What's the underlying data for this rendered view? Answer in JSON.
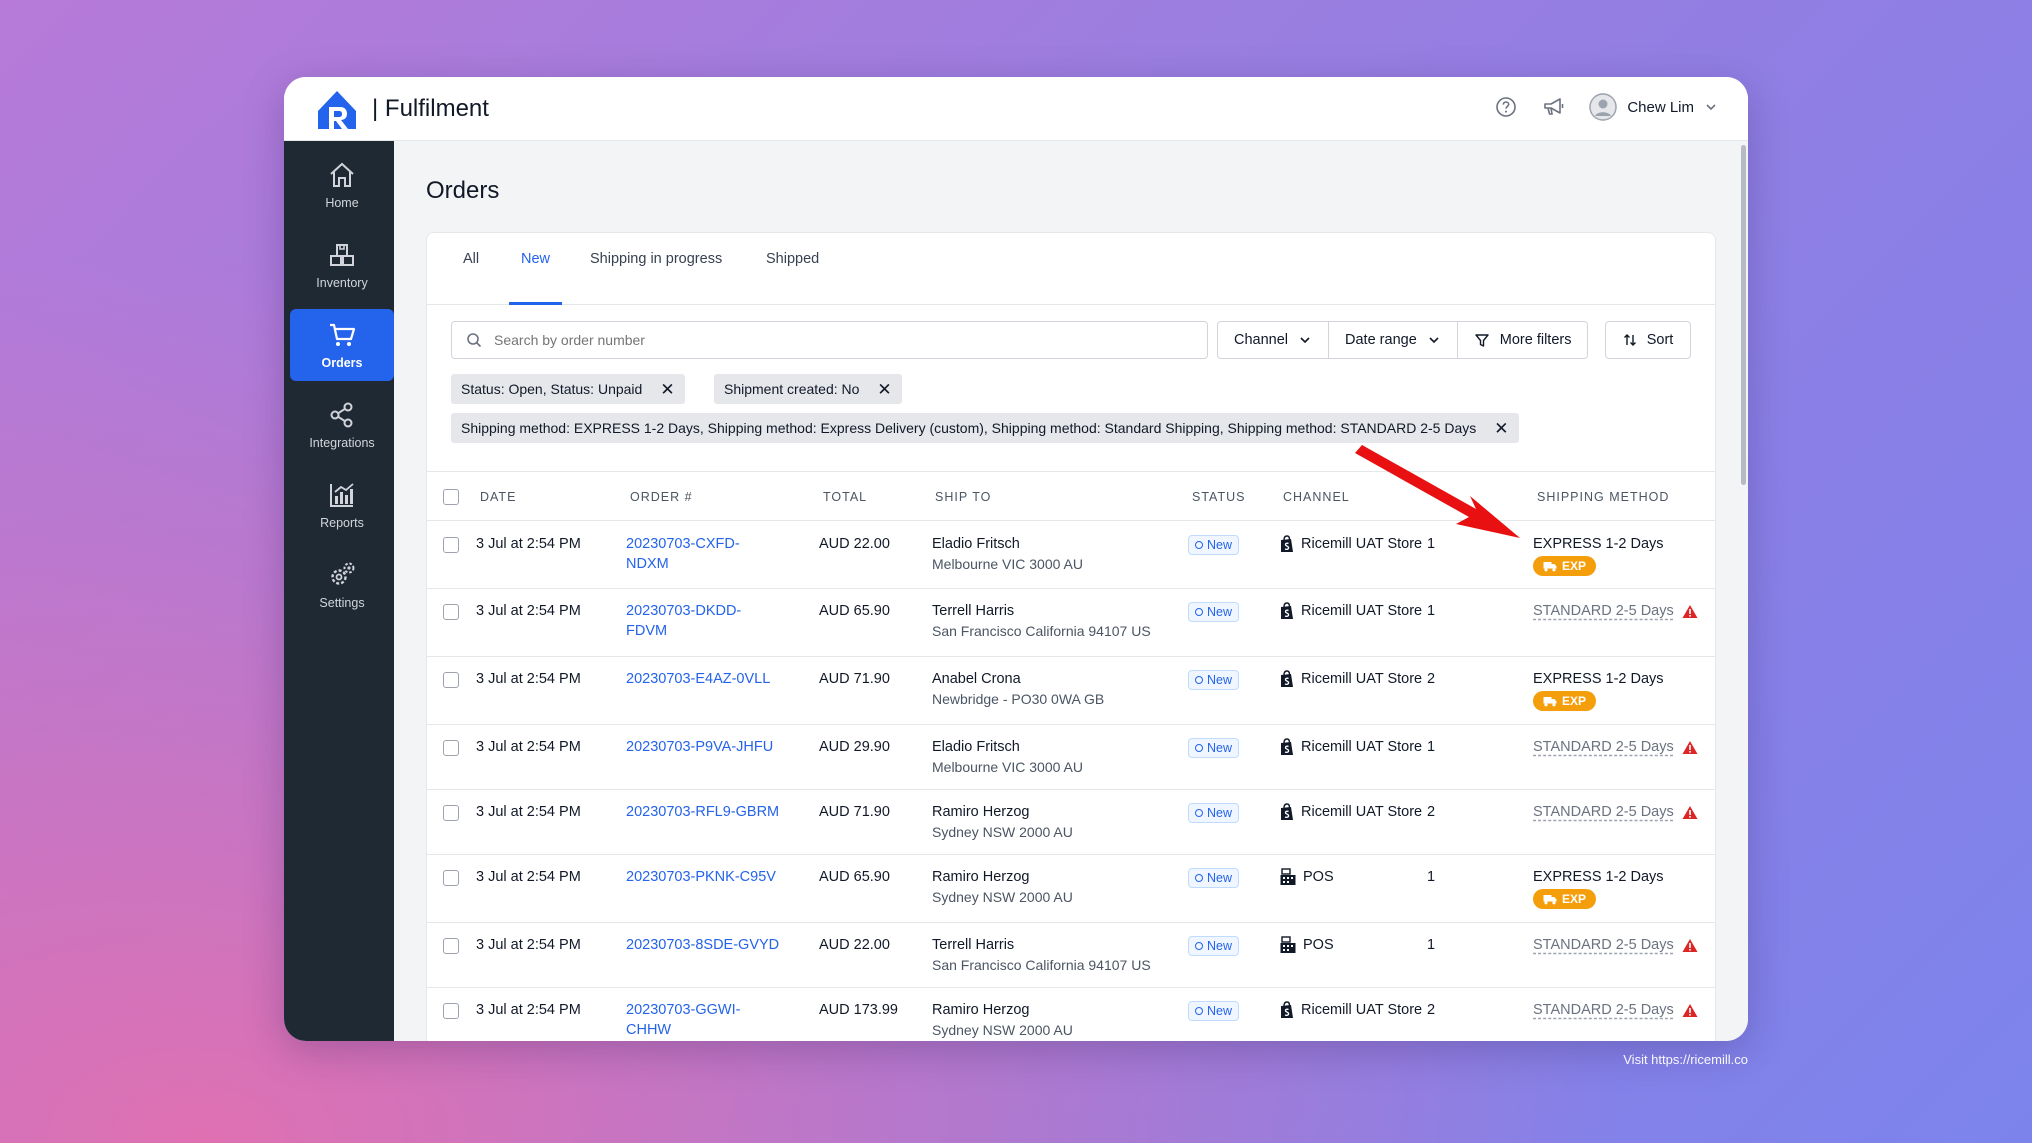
{
  "app": {
    "title": "| Fulfilment",
    "user_name": "Chew Lim"
  },
  "sidebar": {
    "items": [
      {
        "label": "Home",
        "icon": "home-icon"
      },
      {
        "label": "Inventory",
        "icon": "inventory-icon"
      },
      {
        "label": "Orders",
        "icon": "cart-icon",
        "active": true
      },
      {
        "label": "Integrations",
        "icon": "share-icon"
      },
      {
        "label": "Reports",
        "icon": "chart-icon"
      },
      {
        "label": "Settings",
        "icon": "gear-icon"
      }
    ]
  },
  "page": {
    "title": "Orders",
    "tabs": [
      {
        "label": "All"
      },
      {
        "label": "New",
        "active": true
      },
      {
        "label": "Shipping in progress"
      },
      {
        "label": "Shipped"
      }
    ],
    "search_placeholder": "Search by order number",
    "filters": {
      "channel": "Channel",
      "date_range": "Date range",
      "more": "More filters",
      "sort": "Sort"
    },
    "chips": [
      "Status: Open, Status: Unpaid",
      "Shipment created: No",
      "Shipping method: EXPRESS 1-2 Days, Shipping method: Express Delivery (custom), Shipping method: Standard Shipping, Shipping method: STANDARD 2-5 Days"
    ]
  },
  "table": {
    "columns": [
      "DATE",
      "ORDER #",
      "TOTAL",
      "SHIP TO",
      "STATUS",
      "CHANNEL",
      "SHIPPING METHOD"
    ],
    "rows": [
      {
        "date": "3 Jul at 2:54 PM",
        "order_a": "20230703-CXFD-",
        "order_b": "NDXM",
        "total": "AUD 22.00",
        "name": "Eladio Fritsch",
        "address": "Melbourne VIC 3000 AU",
        "status": "New",
        "channel": "Ricemill UAT Store",
        "channel_icon": "shopify-icon",
        "qty": "1",
        "method": "EXPRESS 1-2 Days",
        "express": true
      },
      {
        "date": "3 Jul at 2:54 PM",
        "order_a": "20230703-DKDD-",
        "order_b": "FDVM",
        "total": "AUD 65.90",
        "name": "Terrell Harris",
        "address": "San Francisco California 94107 US",
        "status": "New",
        "channel": "Ricemill UAT Store",
        "channel_icon": "shopify-icon",
        "qty": "1",
        "method": "STANDARD 2-5 Days",
        "express": false
      },
      {
        "date": "3 Jul at 2:54 PM",
        "order_a": "20230703-E4AZ-0VLL",
        "order_b": "",
        "total": "AUD 71.90",
        "name": "Anabel Crona",
        "address": "Newbridge - PO30 0WA GB",
        "status": "New",
        "channel": "Ricemill UAT Store",
        "channel_icon": "shopify-icon",
        "qty": "2",
        "method": "EXPRESS 1-2 Days",
        "express": true
      },
      {
        "date": "3 Jul at 2:54 PM",
        "order_a": "20230703-P9VA-JHFU",
        "order_b": "",
        "total": "AUD 29.90",
        "name": "Eladio Fritsch",
        "address": "Melbourne VIC 3000 AU",
        "status": "New",
        "channel": "Ricemill UAT Store",
        "channel_icon": "shopify-icon",
        "qty": "1",
        "method": "STANDARD 2-5 Days",
        "express": false
      },
      {
        "date": "3 Jul at 2:54 PM",
        "order_a": "20230703-RFL9-GBRM",
        "order_b": "",
        "total": "AUD 71.90",
        "name": "Ramiro Herzog",
        "address": "Sydney NSW 2000 AU",
        "status": "New",
        "channel": "Ricemill UAT Store",
        "channel_icon": "shopify-icon",
        "qty": "2",
        "method": "STANDARD 2-5 Days",
        "express": false
      },
      {
        "date": "3 Jul at 2:54 PM",
        "order_a": "20230703-PKNK-C95V",
        "order_b": "",
        "total": "AUD 65.90",
        "name": "Ramiro Herzog",
        "address": "Sydney NSW 2000 AU",
        "status": "New",
        "channel": "POS",
        "channel_icon": "pos-icon",
        "qty": "1",
        "method": "EXPRESS 1-2 Days",
        "express": true
      },
      {
        "date": "3 Jul at 2:54 PM",
        "order_a": "20230703-8SDE-GVYD",
        "order_b": "",
        "total": "AUD 22.00",
        "name": "Terrell Harris",
        "address": "San Francisco California 94107 US",
        "status": "New",
        "channel": "POS",
        "channel_icon": "pos-icon",
        "qty": "1",
        "method": "STANDARD 2-5 Days",
        "express": false
      },
      {
        "date": "3 Jul at 2:54 PM",
        "order_a": "20230703-GGWI-",
        "order_b": "CHHW",
        "total": "AUD 173.99",
        "name": "Ramiro Herzog",
        "address": "Sydney NSW 2000 AU",
        "status": "New",
        "channel": "Ricemill UAT Store",
        "channel_icon": "shopify-icon",
        "qty": "2",
        "method": "STANDARD 2-5 Days",
        "express": false
      }
    ],
    "exp_label": "EXP"
  },
  "footer": {
    "text": "Visit https://ricemill.co"
  },
  "colors": {
    "accent": "#2463eb",
    "sidebar": "#1f2933",
    "express": "#f59e0b",
    "warning": "#dc2626",
    "arrow": "#e81010"
  }
}
